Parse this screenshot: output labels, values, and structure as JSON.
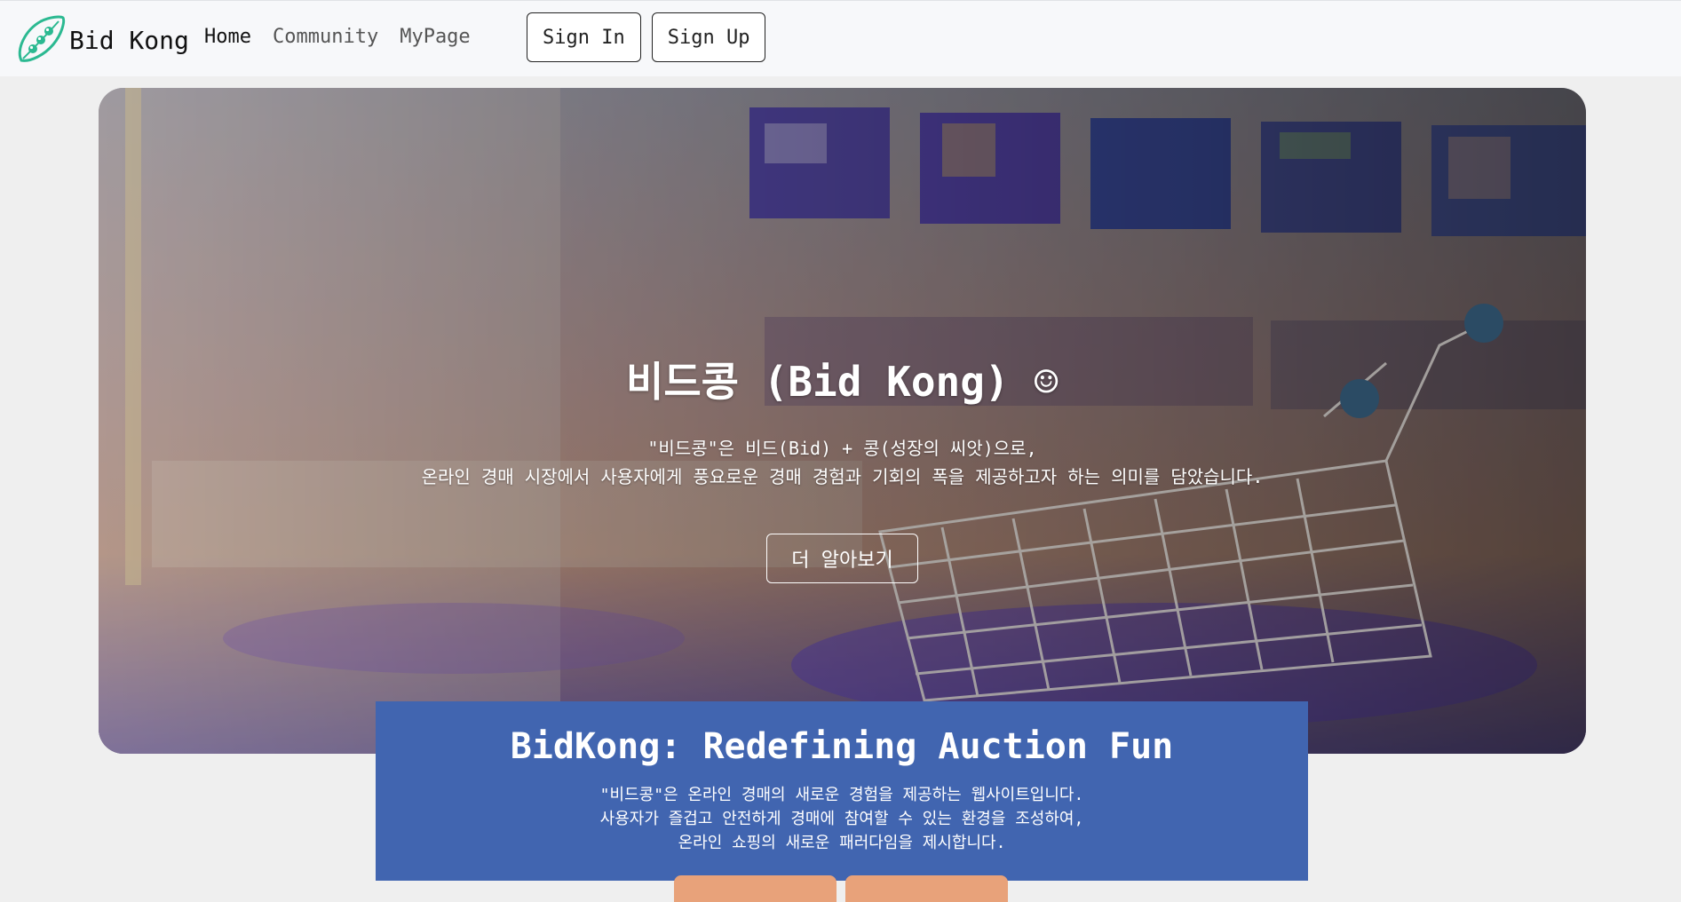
{
  "navbar": {
    "brand": "Bid Kong",
    "links": [
      {
        "label": "Home"
      },
      {
        "label": "Community"
      },
      {
        "label": "MyPage"
      }
    ],
    "sign_in": "Sign In",
    "sign_up": "Sign Up"
  },
  "hero": {
    "title": "비드콩 (Bid Kong) ☺",
    "desc_line1": "\"비드콩\"은 비드(Bid) + 콩(성장의 씨앗)으로,",
    "desc_line2": "온라인 경매 시장에서 사용자에게 풍요로운 경매 경험과 기회의 폭을 제공하고자 하는 의미를 담았습니다.",
    "cta": "더 알아보기"
  },
  "info": {
    "title": "BidKong: Redefining Auction Fun",
    "line1": "\"비드콩\"은 온라인 경매의 새로운 경험을 제공하는 웹사이트입니다.",
    "line2": "사용자가 즐겁고 안전하게 경매에 참여할 수 있는 환경을 조성하여,",
    "line3": "온라인 쇼핑의 새로운 패러다임을 제시합니다."
  },
  "colors": {
    "accent_green": "#2bb991",
    "info_blue": "#4165b0",
    "info_button": "#e8a27a"
  }
}
